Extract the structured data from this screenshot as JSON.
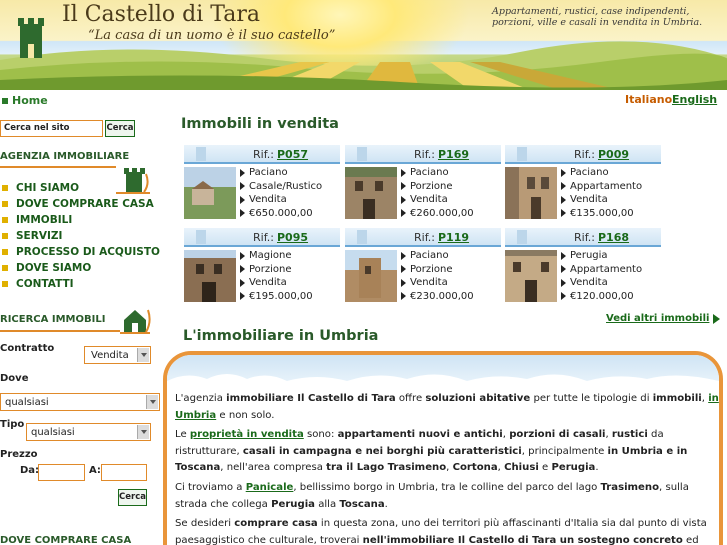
{
  "header": {
    "title": "Il Castello di Tara",
    "motto": "“La casa di un uomo è il suo castello”",
    "blurb": "Appartamenti, rustici, case indipendenti, porzioni, ville e casali in vendita in Umbria."
  },
  "topbar": {
    "home": "Home",
    "lang_it": "Italiano",
    "lang_en": "English"
  },
  "sidebar": {
    "search_placeholder": "Cerca nel sito",
    "search_button": "Cerca",
    "agency_title": "AGENZIA IMMOBILIARE",
    "menu": [
      "CHI SIAMO",
      "DOVE COMPRARE CASA",
      "IMMOBILI",
      "SERVIZI",
      "PROCESSO DI ACQUISTO",
      "DOVE SIAMO",
      "CONTATTI"
    ],
    "search_section_title": "RICERCA IMMOBILI",
    "contratto_label": "Contratto",
    "contratto_value": "Vendita",
    "dove_label": "Dove",
    "dove_value": "qualsiasi",
    "tipo_label": "Tipo",
    "tipo_value": "qualsiasi",
    "prezzo_label": "Prezzo",
    "da_label": "Da:",
    "a_label": "A:",
    "search_submit": "Cerca",
    "bottom_title": "DOVE COMPRARE CASA"
  },
  "main": {
    "listings_title": "Immobili in vendita",
    "ref_label": "Rif.:",
    "listings": [
      {
        "code": "P057",
        "place": "Paciano",
        "type": "Casale/Rustico",
        "contract": "Vendita",
        "price": "€650.000,00"
      },
      {
        "code": "P169",
        "place": "Paciano",
        "type": "Porzione",
        "contract": "Vendita",
        "price": "€260.000,00"
      },
      {
        "code": "P009",
        "place": "Paciano",
        "type": "Appartamento",
        "contract": "Vendita",
        "price": "€135.000,00"
      },
      {
        "code": "P095",
        "place": "Magione",
        "type": "Porzione",
        "contract": "Vendita",
        "price": "€195.000,00"
      },
      {
        "code": "P119",
        "place": "Paciano",
        "type": "Porzione",
        "contract": "Vendita",
        "price": "€230.000,00"
      },
      {
        "code": "P168",
        "place": "Perugia",
        "type": "Appartamento",
        "contract": "Vendita",
        "price": "€120.000,00"
      }
    ],
    "more_link": "Vedi altri immobili",
    "about_title": "L'immobiliare in Umbria",
    "p1": {
      "a": "L'agenzia ",
      "b": "immobiliare Il Castello di Tara",
      "c": " offre ",
      "d": "soluzioni abitative",
      "e": " per tutte le tipologie di ",
      "f": "immobili",
      "g": ", ",
      "h": "in Umbria",
      "i": " e non solo."
    },
    "p2": {
      "a": "Le ",
      "b": "proprietà in vendita",
      "c": " sono: ",
      "d": "appartamenti nuovi e antichi",
      "e": ", ",
      "f": "porzioni di casali",
      "g": ", ",
      "h": "rustici",
      "i": " da ristrutturare, ",
      "j": "casali in campagna e nei borghi più caratteristici",
      "k": ", principalmente ",
      "l": "in Umbria e in Toscana",
      "m": ", nell'area compresa ",
      "n": "tra il Lago Trasimeno",
      "o": ", ",
      "p": "Cortona",
      "q": ", ",
      "r": "Chiusi",
      "s": " e ",
      "t": "Perugia",
      "u": "."
    },
    "p3": {
      "a": "Ci troviamo a ",
      "b": "Panicale",
      "c": ", bellissimo borgo in Umbria, tra le colline del parco del lago ",
      "d": "Trasimeno",
      "e": ", sulla strada che collega ",
      "f": "Perugia",
      "g": " alla ",
      "h": "Toscana",
      "i": "."
    },
    "p4": {
      "a": "Se desideri ",
      "b": "comprare casa",
      "c": " in questa zona, uno dei territori più affascinanti d'Italia sia dal punto di vista paesaggistico che culturale, troverai ",
      "d": "nell'immobiliare Il Castello di Tara un sostegno concreto",
      "e": " ed potrai"
    }
  }
}
